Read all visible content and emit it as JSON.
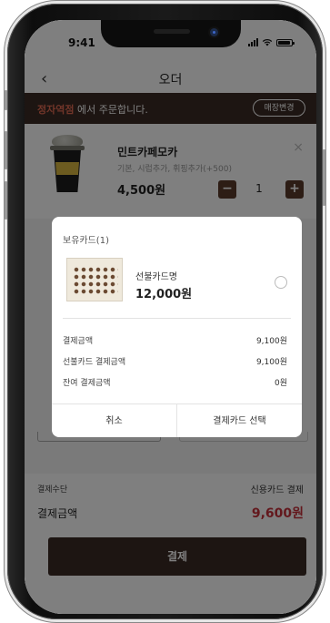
{
  "status": {
    "time": "9:41"
  },
  "nav": {
    "back": "‹",
    "title": "오더"
  },
  "store": {
    "name": "정자역점",
    "suffix": " 에서 주문합니다.",
    "change_label": "매장변경"
  },
  "product": {
    "name": "민트카페모카",
    "options": "기본, 시럽추가, 휘핑추가(+500)",
    "price": "4,500원",
    "quantity": "1",
    "minus": "−",
    "plus": "+",
    "remove": "×"
  },
  "payment": {
    "method_label": "결제수단",
    "method_value": "신용카드 결제",
    "total_label": "결제금액",
    "total_value": "9,600원",
    "pay_button": "결제"
  },
  "modal": {
    "title": "보유카드(1)",
    "card": {
      "name": "선불카드명",
      "amount": "12,000원"
    },
    "rows": [
      {
        "label": "결제금액",
        "value": "9,100원"
      },
      {
        "label": "선불카드 결제금액",
        "value": "9,100원"
      },
      {
        "label": "잔여 결제금액",
        "value": "0원"
      }
    ],
    "cancel_label": "취소",
    "select_label": "결제카드 선택"
  },
  "colors": {
    "brand_dark": "#3a2b24",
    "store_accent": "#e36a52",
    "total_red": "#c7303a"
  },
  "icons": {
    "back": "chevron-left-icon",
    "close": "close-icon",
    "radio": "radio-unchecked-icon"
  }
}
